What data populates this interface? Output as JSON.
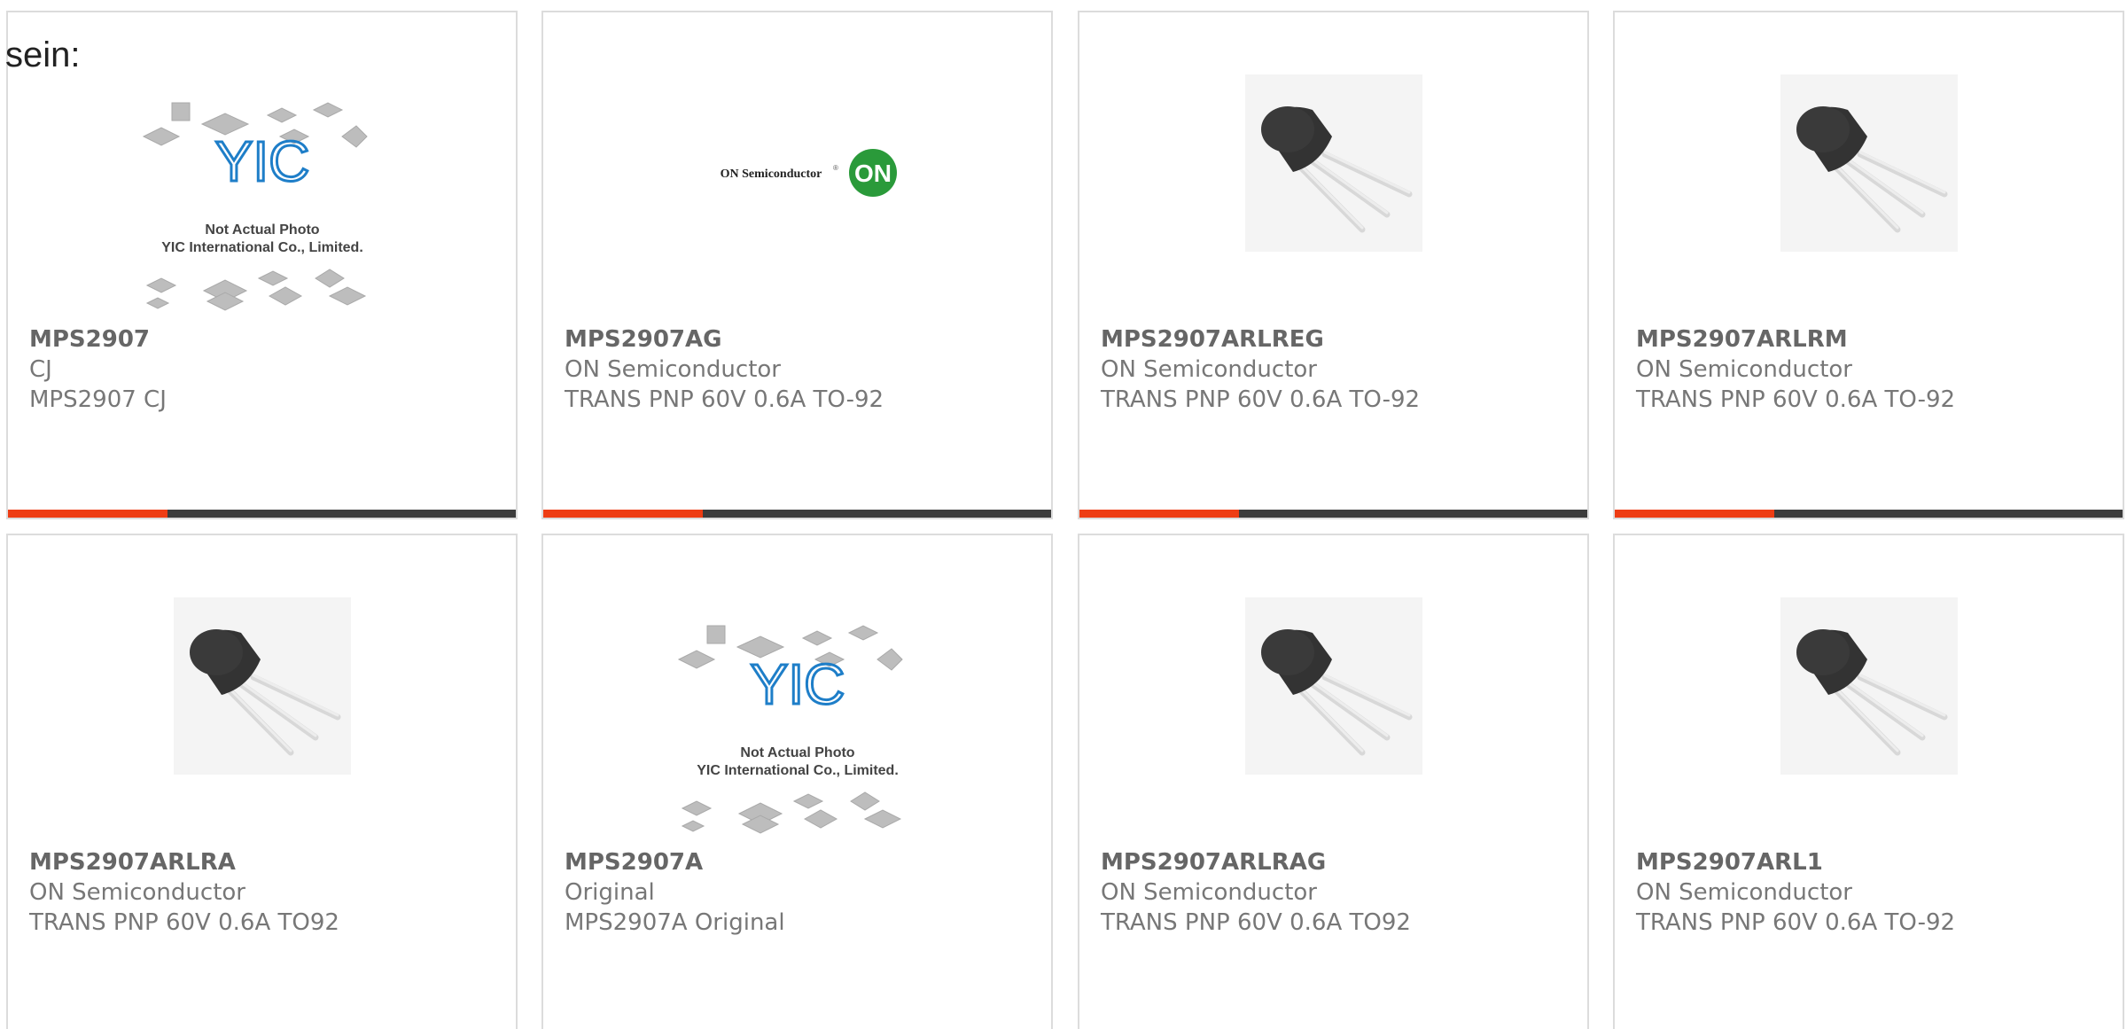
{
  "intro_text": "sein:",
  "colors": {
    "accent": "#ee3d14",
    "bar_track": "#3c3c3c",
    "border": "#dcdcdc",
    "text": "#777777",
    "on_logo": "#2a9a3a"
  },
  "products": [
    {
      "part": "MPS2907",
      "maker": "CJ",
      "desc": "MPS2907 CJ",
      "image": "yic-placeholder"
    },
    {
      "part": "MPS2907AG",
      "maker": "ON Semiconductor",
      "desc": "TRANS PNP 60V 0.6A TO-92",
      "image": "on-logo"
    },
    {
      "part": "MPS2907ARLREG",
      "maker": "ON Semiconductor",
      "desc": "TRANS PNP 60V 0.6A TO-92",
      "image": "transistor-to92"
    },
    {
      "part": "MPS2907ARLRM",
      "maker": "ON Semiconductor",
      "desc": "TRANS PNP 60V 0.6A TO-92",
      "image": "transistor-to92"
    },
    {
      "part": "MPS2907ARLRA",
      "maker": "ON Semiconductor",
      "desc": "TRANS PNP 60V 0.6A TO92",
      "image": "transistor-to92"
    },
    {
      "part": "MPS2907A",
      "maker": "Original",
      "desc": "MPS2907A Original",
      "image": "yic-placeholder"
    },
    {
      "part": "MPS2907ARLRAG",
      "maker": "ON Semiconductor",
      "desc": "TRANS PNP 60V 0.6A TO92",
      "image": "transistor-to92"
    },
    {
      "part": "MPS2907ARL1",
      "maker": "ON Semiconductor",
      "desc": "TRANS PNP 60V 0.6A TO-92",
      "image": "transistor-to92"
    }
  ],
  "yic_photo": {
    "line1": "Not Actual Photo",
    "line2": "YIC International Co., Limited.",
    "brand": "YIC"
  },
  "on_logo": {
    "wordmark": "ON Semiconductor",
    "reg": "®",
    "badge": "ON"
  }
}
